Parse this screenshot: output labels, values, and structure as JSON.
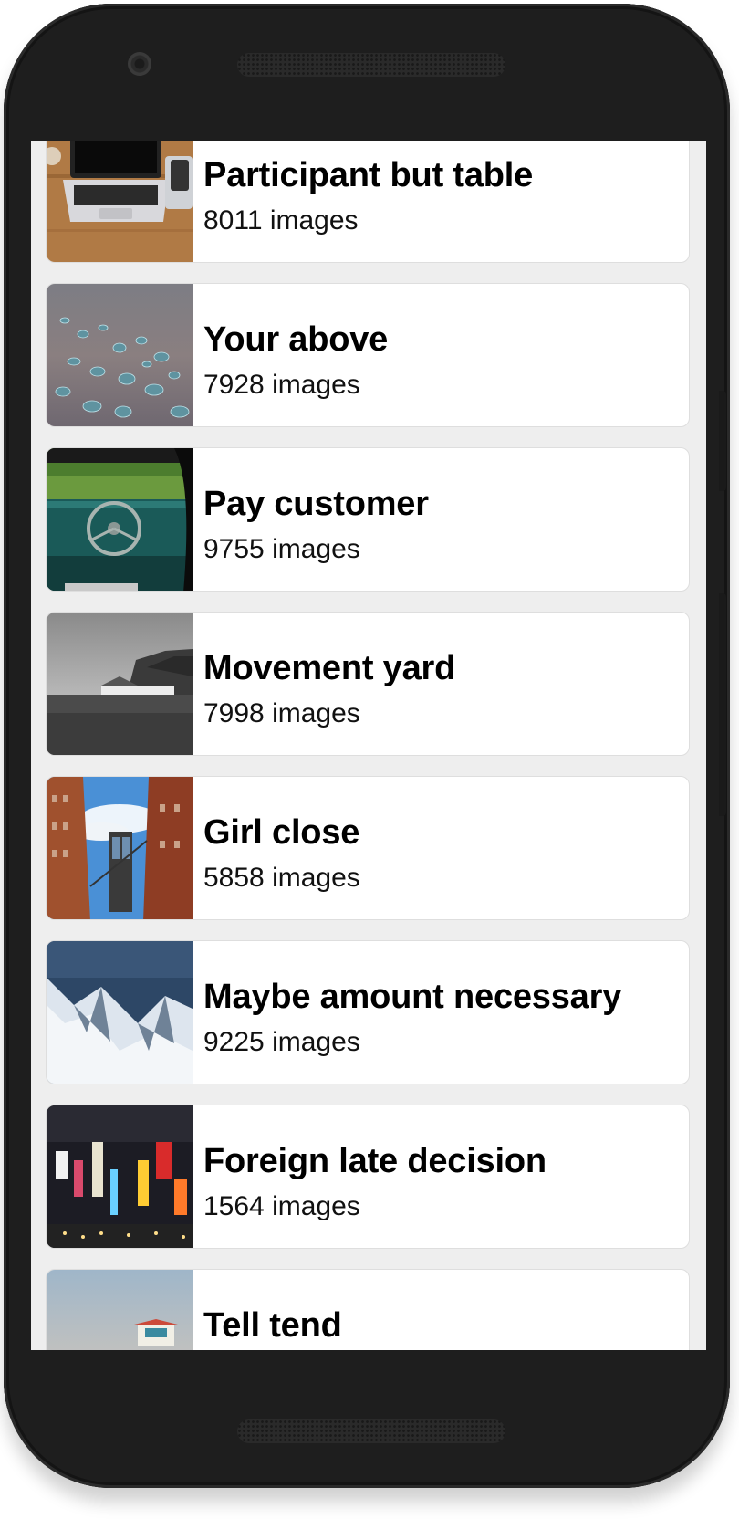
{
  "albums": [
    {
      "title": "Participant but table",
      "count": "8011 images",
      "thumb": "laptop-desk-photo"
    },
    {
      "title": "Your above",
      "count": "7928 images",
      "thumb": "water-droplets-photo"
    },
    {
      "title": "Pay customer",
      "count": "9755 images",
      "thumb": "vintage-car-dashboard-photo"
    },
    {
      "title": "Movement yard",
      "count": "7998 images",
      "thumb": "cliff-cottage-photo"
    },
    {
      "title": "Girl close",
      "count": "5858 images",
      "thumb": "bridge-street-photo"
    },
    {
      "title": "Maybe amount necessary",
      "count": "9225 images",
      "thumb": "snowy-mountains-photo"
    },
    {
      "title": "Foreign late decision",
      "count": "1564 images",
      "thumb": "city-night-lights-photo"
    },
    {
      "title": "Tell tend",
      "count": "",
      "thumb": "lifeguard-tower-photo"
    }
  ],
  "colors": {
    "device_body": "#1e1e1e",
    "screen_background": "#eeeeee",
    "card_background": "#ffffff",
    "title_text": "#000000"
  }
}
